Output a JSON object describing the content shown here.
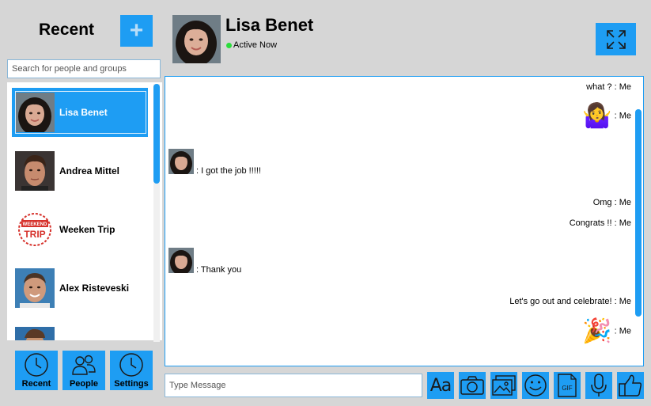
{
  "sidebar": {
    "title": "Recent",
    "add_label": "+",
    "search_placeholder": "Search for people and groups",
    "contacts": [
      {
        "name": "Lisa Benet",
        "avatar": "woman-avatar",
        "active": true
      },
      {
        "name": "Andrea Mittel",
        "avatar": "man-avatar",
        "active": false
      },
      {
        "name": "Weeken Trip",
        "avatar": "weekend-trip-logo",
        "active": false
      },
      {
        "name": "Alex Risteveski",
        "avatar": "man-avatar",
        "active": false
      }
    ],
    "nav": [
      {
        "label": "Recent",
        "icon": "clock-icon"
      },
      {
        "label": "People",
        "icon": "people-icon"
      },
      {
        "label": "Settings",
        "icon": "clock-icon"
      }
    ],
    "logo_text": [
      "WEEKEND",
      "TRIP"
    ]
  },
  "header": {
    "name": "Lisa Benet",
    "status": "Active Now",
    "status_color": "#2bdd3c"
  },
  "chat": {
    "messages": [
      {
        "side": "right",
        "text": "what ? : Me"
      },
      {
        "side": "right",
        "emoji": "🤷‍♀️",
        "text": ": Me"
      },
      {
        "side": "left",
        "text": ": I got the job !!!!!"
      },
      {
        "side": "right",
        "text": "Omg : Me"
      },
      {
        "side": "right",
        "text": "Congrats !! : Me"
      },
      {
        "side": "left",
        "text": ": Thank you"
      },
      {
        "side": "right",
        "text": "Let's go out and celebrate! : Me"
      },
      {
        "side": "right",
        "emoji": "🎉",
        "text": ": Me"
      }
    ]
  },
  "composer": {
    "placeholder": "Type Message",
    "font_label": "Aa",
    "gif_label": "GIF"
  },
  "colors": {
    "accent": "#1e9df3",
    "background": "#d6d6d6"
  }
}
